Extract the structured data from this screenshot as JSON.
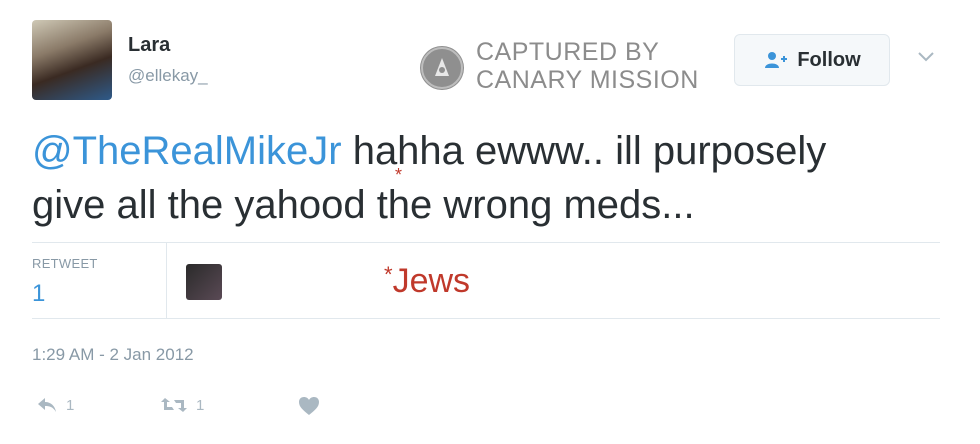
{
  "user": {
    "name": "Lara",
    "handle": "@ellekay_"
  },
  "watermark": {
    "line1": "CAPTURED BY",
    "line2": "CANARY MISSION"
  },
  "follow_button": {
    "label": "Follow"
  },
  "tweet": {
    "mention": "@TheRealMikeJr",
    "line1_rest": " hahha ewww.. ill purposely",
    "line2": "give all the yahood the wrong meds..."
  },
  "annotation": {
    "asterisk": "*",
    "note_star": "*",
    "note_text": "Jews"
  },
  "stats": {
    "retweet_label": "RETWEET",
    "retweet_count": "1"
  },
  "timestamp": "1:29 AM - 2 Jan 2012",
  "actions": {
    "reply_count": "1",
    "retweet_count": "1"
  },
  "colors": {
    "link": "#3b94d9",
    "annotation": "#c0392b",
    "muted": "#8899a6"
  }
}
